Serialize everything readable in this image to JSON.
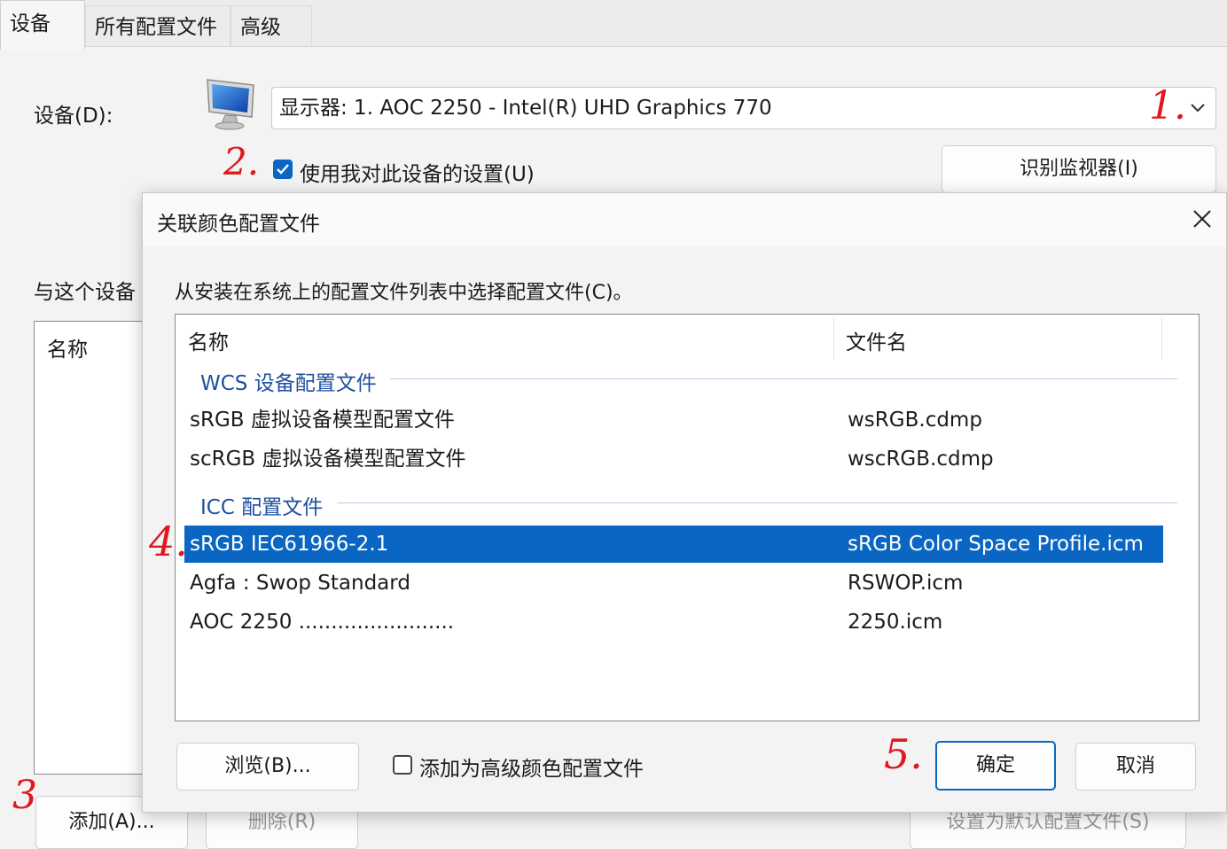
{
  "tabs": [
    {
      "label": "设备",
      "active": true
    },
    {
      "label": "所有配置文件",
      "active": false
    },
    {
      "label": "高级",
      "active": false
    }
  ],
  "device": {
    "label": "设备(D):",
    "selected": "显示器: 1. AOC 2250 - Intel(R) UHD Graphics 770",
    "use_settings_label": "使用我对此设备的设置(U)",
    "use_settings_checked": true,
    "identify_button": "识别监视器(I)"
  },
  "background": {
    "associated_label": "与这个设备",
    "list_header_name": "名称",
    "add_button": "添加(A)...",
    "remove_button": "删除(R)",
    "set_default_button": "设置为默认配置文件(S)"
  },
  "annotations": [
    "1.",
    "2.",
    "3.",
    "4.",
    "5."
  ],
  "dialog": {
    "title": "关联颜色配置文件",
    "instruction": "从安装在系统上的配置文件列表中选择配置文件(C)。",
    "columns": {
      "name": "名称",
      "file": "文件名"
    },
    "groups": [
      {
        "label": "WCS 设备配置文件",
        "items": [
          {
            "name": "sRGB 虚拟设备模型配置文件",
            "file": "wsRGB.cdmp",
            "selected": false
          },
          {
            "name": "scRGB 虚拟设备模型配置文件",
            "file": "wscRGB.cdmp",
            "selected": false
          }
        ]
      },
      {
        "label": "ICC 配置文件",
        "items": [
          {
            "name": "sRGB IEC61966-2.1",
            "file": "sRGB Color Space Profile.icm",
            "selected": true
          },
          {
            "name": "Agfa : Swop Standard",
            "file": "RSWOP.icm",
            "selected": false
          },
          {
            "name": "AOC 2250 ........................",
            "file": "2250.icm",
            "selected": false
          }
        ]
      }
    ],
    "browse_button": "浏览(B)...",
    "advanced_checkbox_label": "添加为高级颜色配置文件",
    "advanced_checked": false,
    "ok_button": "确定",
    "cancel_button": "取消"
  },
  "colors": {
    "accent": "#0a66c2",
    "annotation": "#e0171f"
  }
}
